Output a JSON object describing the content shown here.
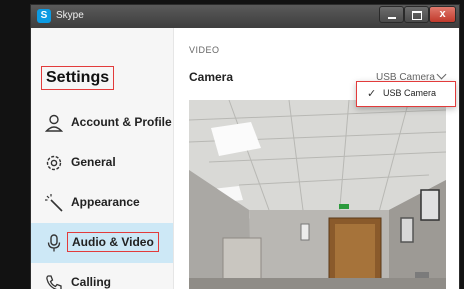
{
  "window": {
    "title": "Skype",
    "app_icon_letter": "S",
    "close_glyph": "x"
  },
  "sidebar": {
    "title": "Settings",
    "items": [
      {
        "label": "Account & Profile",
        "icon": "person-icon"
      },
      {
        "label": "General",
        "icon": "gear-icon"
      },
      {
        "label": "Appearance",
        "icon": "magic-wand-icon"
      },
      {
        "label": "Audio & Video",
        "icon": "microphone-icon",
        "active": true
      },
      {
        "label": "Calling",
        "icon": "phone-icon"
      }
    ]
  },
  "content": {
    "section": "VIDEO",
    "camera_label": "Camera",
    "camera_selected": "USB Camera",
    "dropdown_options": [
      "USB Camera"
    ]
  },
  "colors": {
    "accent": "#0c9be3",
    "highlight_border": "#e23b3b",
    "active_bg": "#cde8f6"
  }
}
